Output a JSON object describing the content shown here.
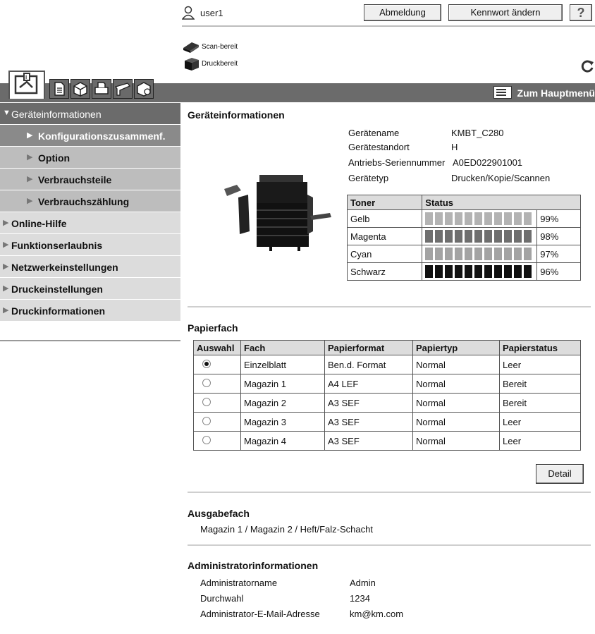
{
  "user": {
    "name": "user1",
    "logout_label": "Abmeldung",
    "change_password_label": "Kennwort ändern",
    "help_label": "?"
  },
  "device_status": [
    {
      "label": "Scan-bereit",
      "icon": "scanner-icon"
    },
    {
      "label": "Druckbereit",
      "icon": "printer-icon"
    }
  ],
  "header": {
    "main_menu_label": "Zum Hauptmenü"
  },
  "sidebar": {
    "items": [
      {
        "label": "Geräteinformationen",
        "level": "section",
        "expanded": true
      },
      {
        "label": "Konfigurationszusammenf.",
        "level": "sub",
        "active": true
      },
      {
        "label": "Option",
        "level": "sub"
      },
      {
        "label": "Verbrauchsteile",
        "level": "sub"
      },
      {
        "label": "Verbrauchszählung",
        "level": "sub"
      },
      {
        "label": "Online-Hilfe",
        "level": "top"
      },
      {
        "label": "Funktionserlaubnis",
        "level": "top"
      },
      {
        "label": "Netzwerkeinstellungen",
        "level": "top"
      },
      {
        "label": "Druckeinstellungen",
        "level": "top"
      },
      {
        "label": "Druckinformationen",
        "level": "top"
      }
    ]
  },
  "device_info": {
    "title": "Geräteinformationen",
    "rows": [
      {
        "label": "Gerätename",
        "value": "KMBT_C280"
      },
      {
        "label": "Gerätestandort",
        "value": "H"
      },
      {
        "label": "Antriebs-Seriennummer",
        "value": "A0ED022901001"
      },
      {
        "label": "Gerätetyp",
        "value": "Drucken/Kopie/Scannen"
      }
    ]
  },
  "toner": {
    "headers": [
      "Toner",
      "Status"
    ],
    "rows": [
      {
        "name": "Gelb",
        "percent": "99%",
        "level": 0.99,
        "color": "#b3b3b3"
      },
      {
        "name": "Magenta",
        "percent": "98%",
        "level": 0.98,
        "color": "#6e6e6e"
      },
      {
        "name": "Cyan",
        "percent": "97%",
        "level": 0.97,
        "color": "#a3a3a3"
      },
      {
        "name": "Schwarz",
        "percent": "96%",
        "level": 0.96,
        "color": "#111111"
      }
    ]
  },
  "paper_tray": {
    "title": "Papierfach",
    "headers": [
      "Auswahl",
      "Fach",
      "Papierformat",
      "Papiertyp",
      "Papierstatus"
    ],
    "rows": [
      {
        "selected": true,
        "tray": "Einzelblatt",
        "format": "Ben.d. Format",
        "type": "Normal",
        "status": "Leer"
      },
      {
        "selected": false,
        "tray": "Magazin 1",
        "format": "A4 LEF",
        "type": "Normal",
        "status": "Bereit"
      },
      {
        "selected": false,
        "tray": "Magazin 2",
        "format": "A3 SEF",
        "type": "Normal",
        "status": "Bereit"
      },
      {
        "selected": false,
        "tray": "Magazin 3",
        "format": "A3 SEF",
        "type": "Normal",
        "status": "Leer"
      },
      {
        "selected": false,
        "tray": "Magazin 4",
        "format": "A3 SEF",
        "type": "Normal",
        "status": "Leer"
      }
    ],
    "detail_label": "Detail"
  },
  "output_tray": {
    "title": "Ausgabefach",
    "value": "Magazin 1 / Magazin 2 / Heft/Falz-Schacht"
  },
  "admin_info": {
    "title": "Administratorinformationen",
    "rows": [
      {
        "label": "Administratorname",
        "value": "Admin"
      },
      {
        "label": "Durchwahl",
        "value": "1234"
      },
      {
        "label": "Administrator-E-Mail-Adresse",
        "value": "km@km.com"
      }
    ]
  }
}
